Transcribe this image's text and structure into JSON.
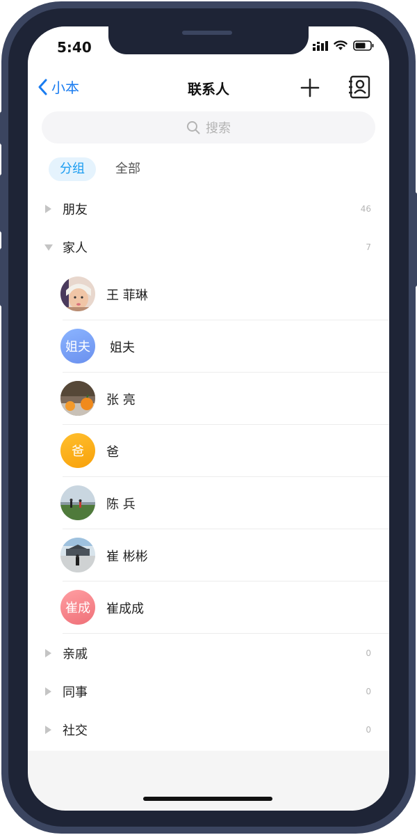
{
  "status_bar": {
    "time": "5:40"
  },
  "header": {
    "back_label": "小本",
    "title": "联系人"
  },
  "search": {
    "placeholder": "搜索"
  },
  "tabs": [
    {
      "label": "分组",
      "active": true
    },
    {
      "label": "全部",
      "active": false
    }
  ],
  "groups": [
    {
      "name": "朋友",
      "count": "46",
      "expanded": false
    },
    {
      "name": "家人",
      "count": "7",
      "expanded": true,
      "contacts": [
        {
          "name": "王 菲琳",
          "avatar": "photo-girl"
        },
        {
          "name": "姐夫",
          "avatar_text": "姐夫",
          "avatar_color": "#6f9ff7"
        },
        {
          "name": "张 亮",
          "avatar": "photo-oranges"
        },
        {
          "name": "爸",
          "avatar_text": "爸",
          "avatar_color": "#fcaa12"
        },
        {
          "name": "陈 兵",
          "avatar": "photo-field"
        },
        {
          "name": "崔 彬彬",
          "avatar": "photo-building"
        },
        {
          "name": "崔成成",
          "avatar_text": "崔成",
          "avatar_color": "#f47e84"
        }
      ]
    },
    {
      "name": "亲戚",
      "count": "0",
      "expanded": false
    },
    {
      "name": "同事",
      "count": "0",
      "expanded": false
    },
    {
      "name": "社交",
      "count": "0",
      "expanded": false
    }
  ],
  "colors": {
    "accent": "#1a7cf0",
    "tab_active_bg": "#e5f3fd",
    "tab_active_text": "#1a9cf0",
    "frame": "#3b4560"
  }
}
